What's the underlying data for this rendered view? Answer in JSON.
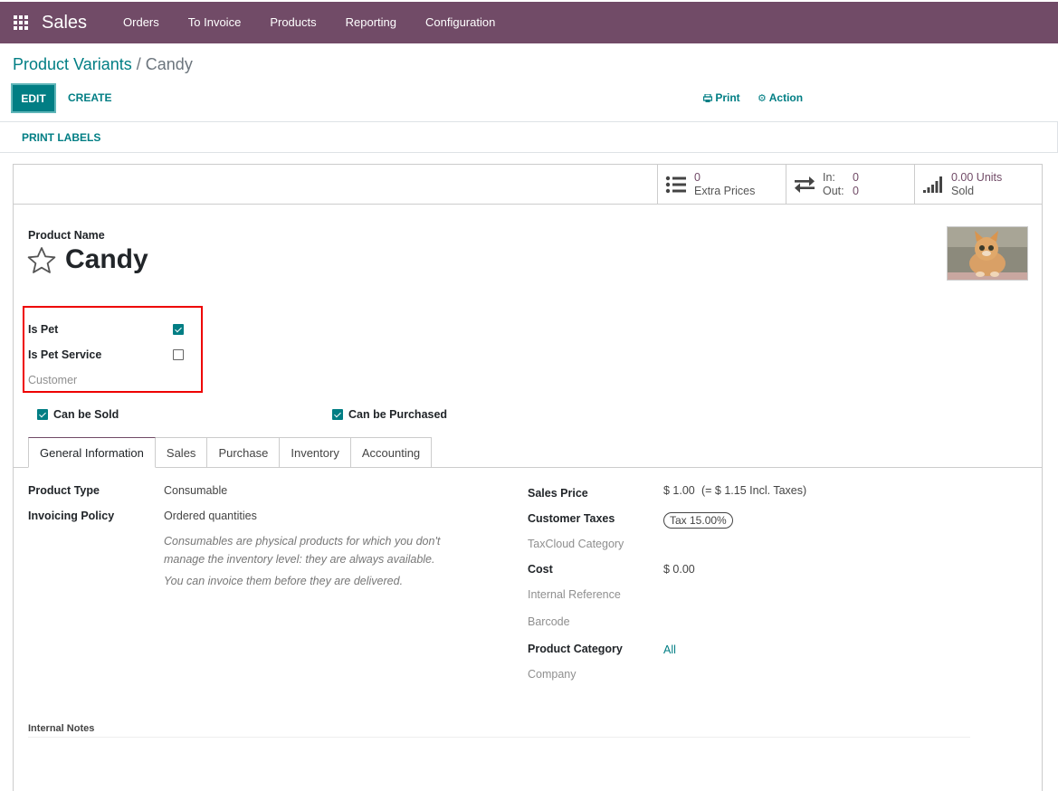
{
  "app": {
    "name": "Sales",
    "menu": [
      "Orders",
      "To Invoice",
      "Products",
      "Reporting",
      "Configuration"
    ]
  },
  "breadcrumb": {
    "parent": "Product Variants",
    "separator": "/",
    "current": "Candy"
  },
  "toolbar": {
    "edit": "EDIT",
    "create": "CREATE",
    "print": "Print",
    "action": "Action"
  },
  "statusbar": {
    "print_labels": "PRINT LABELS"
  },
  "smart_buttons": {
    "extra_prices": {
      "value": "0",
      "label": "Extra Prices"
    },
    "in_out": {
      "in_label": "In:",
      "in_value": "0",
      "out_label": "Out:",
      "out_value": "0"
    },
    "sold": {
      "value": "0.00 Units",
      "label": "Sold"
    }
  },
  "product": {
    "name_label": "Product Name",
    "name": "Candy",
    "image": "kitten-photo"
  },
  "custom_fields": {
    "is_pet": {
      "label": "Is Pet",
      "checked": true
    },
    "is_pet_service": {
      "label": "Is Pet Service",
      "checked": false
    },
    "customer": {
      "label": "Customer"
    }
  },
  "options": {
    "can_be_sold": {
      "label": "Can be Sold",
      "checked": true
    },
    "can_be_purchased": {
      "label": "Can be Purchased",
      "checked": true
    }
  },
  "tabs": [
    "General Information",
    "Sales",
    "Purchase",
    "Inventory",
    "Accounting"
  ],
  "active_tab": "General Information",
  "general": {
    "product_type": {
      "label": "Product Type",
      "value": "Consumable"
    },
    "invoicing_policy": {
      "label": "Invoicing Policy",
      "value": "Ordered quantities"
    },
    "help_1": "Consumables are physical products for which you don't",
    "help_2": "manage the inventory level: they are always available.",
    "help_3": "You can invoice them before they are delivered.",
    "sales_price": {
      "label": "Sales Price",
      "value": "$ 1.00",
      "incl": "(= $ 1.15 Incl. Taxes)"
    },
    "customer_taxes": {
      "label": "Customer Taxes",
      "value": "Tax 15.00%"
    },
    "taxcloud_category": {
      "label": "TaxCloud Category"
    },
    "cost": {
      "label": "Cost",
      "value": "$ 0.00"
    },
    "internal_reference": {
      "label": "Internal Reference"
    },
    "barcode": {
      "label": "Barcode"
    },
    "product_category": {
      "label": "Product Category",
      "value": "All"
    },
    "company": {
      "label": "Company"
    },
    "internal_notes": {
      "label": "Internal Notes"
    }
  },
  "colors": {
    "brand": "#714b67",
    "accent": "#017e84",
    "highlight": "#ee0000"
  }
}
